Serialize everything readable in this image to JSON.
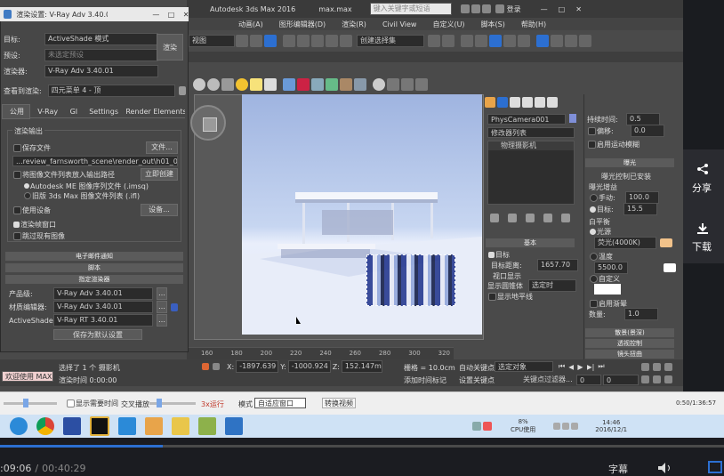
{
  "max": {
    "title": "Autodesk 3ds Max 2016",
    "file": "max.max",
    "search_placeholder": "键入关键字或短语",
    "login": "登录",
    "menu": [
      "动画(A)",
      "图形编辑器(D)",
      "渲染(R)",
      "Civil View",
      "自定义(U)",
      "脚本(S)",
      "帮助(H)"
    ],
    "view_dropdown": "视图",
    "selection_set": "创建选择集",
    "tool_icons": [
      "teapot",
      "sphere",
      "cone",
      "sun",
      "star",
      "grid"
    ],
    "cmd_tab_icons": [
      "create",
      "modify",
      "hierarchy",
      "motion",
      "display",
      "utilities"
    ],
    "camera_name": "PhysCamera001",
    "modifier_list": "修改器列表",
    "stack_item": "物理摄影机",
    "right_props": {
      "shutter_label": "快门",
      "type_label": "类型:",
      "duration_label": "持续时间:",
      "duration_value": "0.5",
      "offset_label": "偏移:",
      "offset_value": "0.0",
      "motion_blur": "启用运动模糊",
      "exposure_title": "曝光",
      "exposure_gain_label": "曝光控制已安装",
      "exposure_gain": "曝光增益",
      "manual_label": "手动:",
      "manual_value": "100.0",
      "target_label": "目标:",
      "target_value": "15.5",
      "white_balance": "白平衡",
      "illuminant_label": "光源",
      "illuminant_value": "荧光(4000K)",
      "temperature_label": "温度",
      "temperature_value": "5500.0",
      "custom_label": "自定义",
      "vignette_label": "启用渐晕",
      "vignette_amount_label": "数量:",
      "vignette_amount": "1.0",
      "sections": [
        "散景(景深)",
        "透视控制",
        "镜头扭曲"
      ]
    },
    "basic": {
      "title": "基本",
      "target": "目标",
      "target_distance_label": "目标距离:",
      "target_distance_value": "1657.70",
      "viewport_display": "视口显示",
      "show_cone_label": "显示圆锥体",
      "show_cone_value": "选定时",
      "show_horizon": "显示地平线"
    },
    "timeline_ticks": [
      "160",
      "180",
      "200",
      "220",
      "240",
      "260",
      "280",
      "300",
      "320"
    ],
    "status": {
      "selected": "选择了 1 个 摄影机",
      "x_label": "X:",
      "x_value": "-1897.639",
      "y_label": "Y:",
      "y_value": "-1000.924",
      "z_label": "Z:",
      "z_value": "152.147m",
      "grid": "栅格 = 10.0cm",
      "welcome": "欢迎使用 MAXSc",
      "render_time": "渲染时间 0:00:00",
      "add_time_tag": "添加时间标记",
      "auto_key": "自动关键点",
      "set_key": "设置关键点",
      "key_mode": "选定对象",
      "key_filter": "关键点过滤器...",
      "frame": "0",
      "frame_total": "0"
    }
  },
  "render_setup": {
    "title": "渲染设置: V-Ray Adv 3.40.01",
    "target_label": "目标:",
    "target_value": "ActiveShade 模式",
    "preset_label": "预设:",
    "preset_value": "未选定预设",
    "renderer_label": "渲染器:",
    "renderer_value": "V-Ray Adv 3.40.01",
    "render_button": "渲染",
    "view_label": "查看到渲染:",
    "view_value": "四元菜单 4 - 顶",
    "tabs": [
      "公用",
      "V-Ray",
      "GI",
      "Settings",
      "Render Elements"
    ],
    "render_output": "渲染输出",
    "save_file": "保存文件",
    "files_button": "文件...",
    "output_path": "...review_farnsworth_scene\\render_out\\h01_01_test_.png",
    "sequence": "将图像文件列表放入输出路径",
    "create_now": "立即创建",
    "autodesk_seq": "Autodesk ME 图像序列文件 (.imsq)",
    "legacy_seq": "旧版 3ds Max 图像文件列表 (.ifl)",
    "use_device": "使用设备",
    "devices_button": "设备...",
    "rendered_frame": "渲染帧窗口",
    "skip_existing": "跳过现有图像",
    "rollouts": [
      "电子邮件通知",
      "脚本",
      "指定渲染器"
    ],
    "production_label": "产品级:",
    "production_value": "V-Ray Adv 3.40.01",
    "material_label": "材质编辑器:",
    "material_value": "V-Ray Adv 3.40.01",
    "activeshade_label": "ActiveShade:",
    "activeshade_value": "V-Ray RT 3.40.01",
    "save_default": "保存为默认设置"
  },
  "player": {
    "prev_mode": "显示需要时间",
    "play_speed": "交叉播放",
    "speed_note": "3x运行",
    "mode_label": "模式",
    "mode_value": "自适应窗口",
    "stop_btn": "转换视频",
    "time_right": "0:50/1:36:57",
    "current_time": ":09:06",
    "total_time": "00:40:29",
    "subtitle": "字幕",
    "share": "分享",
    "download": "下载"
  },
  "taskbar": {
    "apps": [
      "baidu",
      "chrome",
      "vpn",
      "3dsmax",
      "cloud",
      "paint",
      "folder",
      "notes",
      "player"
    ],
    "cpu_percent": "8%",
    "cpu_label": "CPU使用",
    "time": "14:46",
    "date": "2016/12/1"
  },
  "colors": {
    "accent_blue": "#2c6fd1",
    "orange": "#e8a44a",
    "red": "#c0392b"
  }
}
